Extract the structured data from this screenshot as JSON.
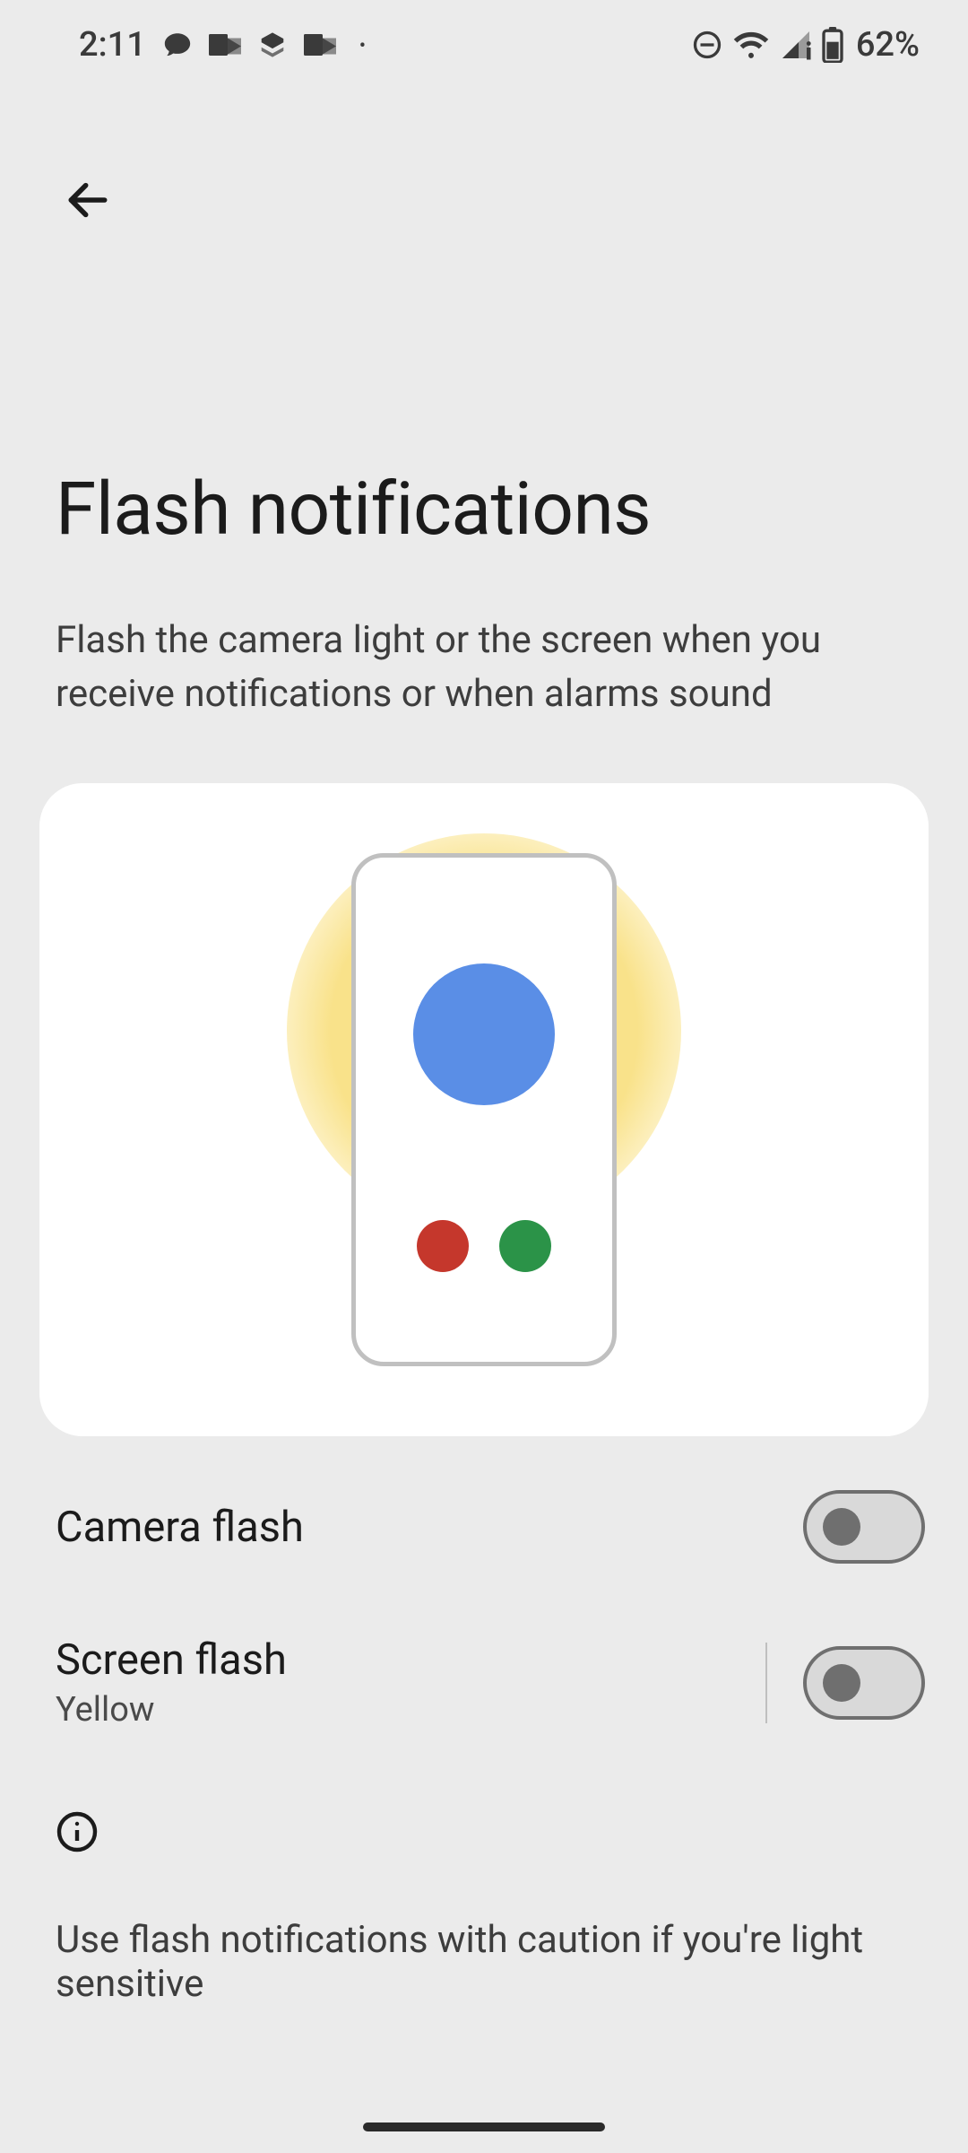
{
  "status": {
    "time": "2:11",
    "battery": "62%"
  },
  "page": {
    "title": "Flash notifications",
    "description": "Flash the camera light or the screen when you receive notifications or when alarms sound"
  },
  "settings": {
    "cameraFlash": {
      "title": "Camera flash",
      "on": false
    },
    "screenFlash": {
      "title": "Screen flash",
      "subtitle": "Yellow",
      "on": false
    }
  },
  "info": {
    "text": "Use flash notifications with caution if you're light sensitive"
  }
}
